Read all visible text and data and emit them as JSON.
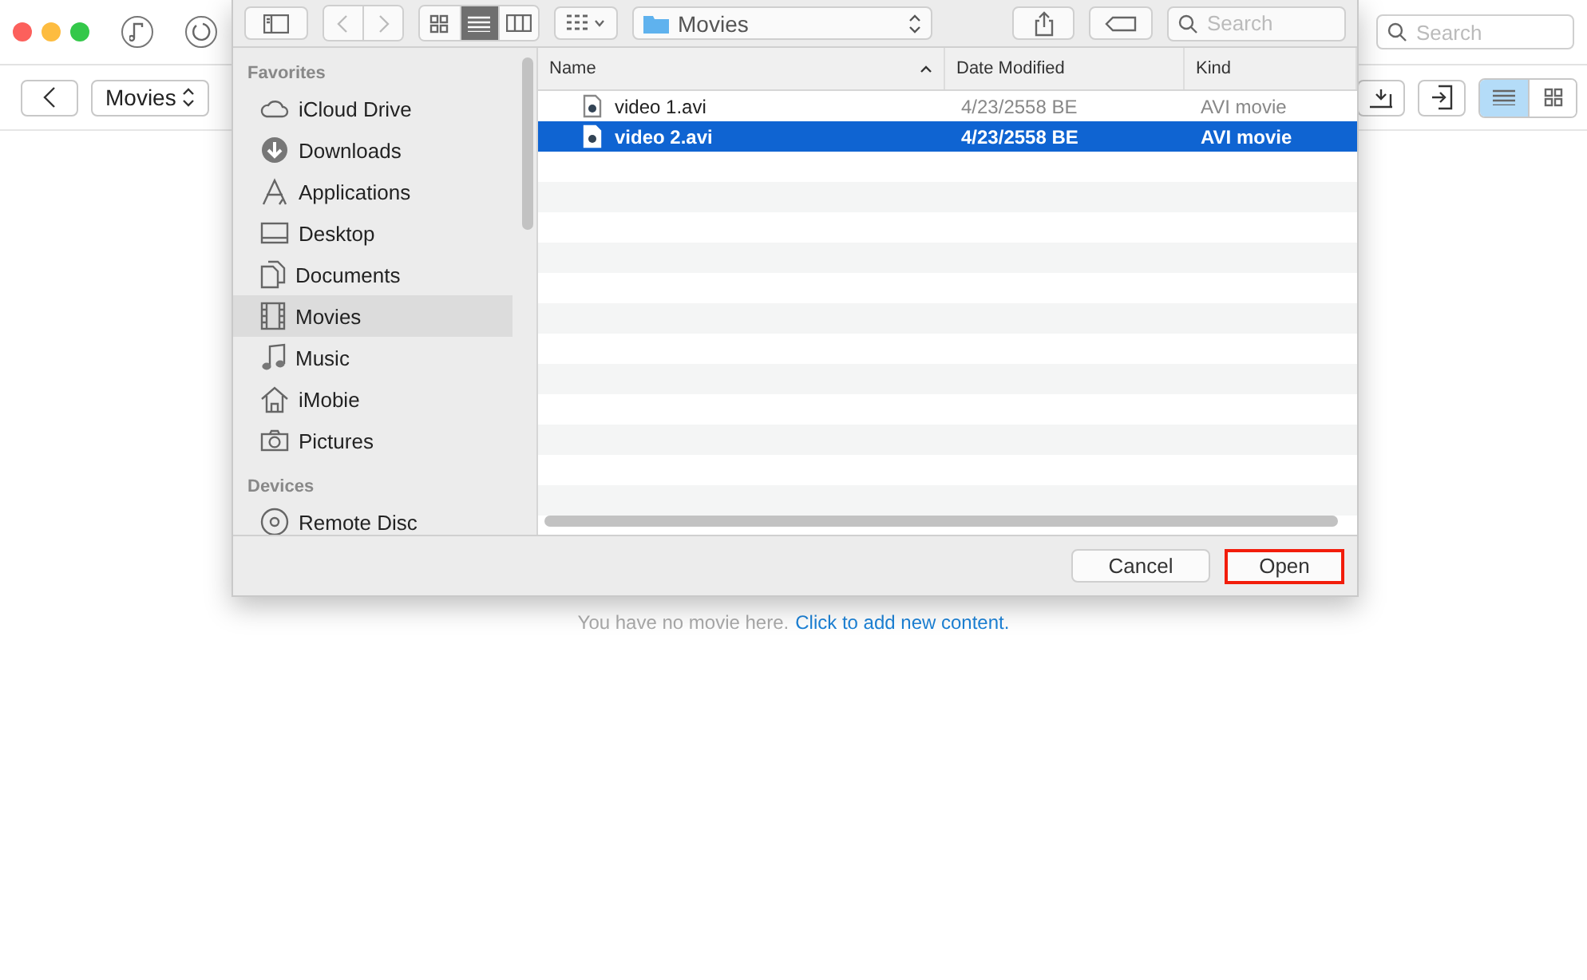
{
  "app": {
    "search": {
      "placeholder": "Search"
    },
    "location": "Movies",
    "view_buttons": [
      {
        "kind": "list",
        "selected": true
      },
      {
        "kind": "grid",
        "selected": false
      }
    ],
    "empty_message": {
      "text": "You have no movie here.",
      "link": "Click to add new content."
    }
  },
  "dialog": {
    "view_buttons": [
      {
        "kind": "icons",
        "selected": false
      },
      {
        "kind": "list",
        "selected": true
      },
      {
        "kind": "columns",
        "selected": false
      }
    ],
    "location": "Movies",
    "search": {
      "placeholder": "Search"
    },
    "sidebar": [
      {
        "heading": "Favorites",
        "items": [
          {
            "label": "iCloud Drive",
            "kind": "cloud",
            "selected": false
          },
          {
            "label": "Downloads",
            "kind": "download",
            "selected": false
          },
          {
            "label": "Applications",
            "kind": "apps",
            "selected": false
          },
          {
            "label": "Desktop",
            "kind": "desktop",
            "selected": false
          },
          {
            "label": "Documents",
            "kind": "documents",
            "selected": false
          },
          {
            "label": "Movies",
            "kind": "film",
            "selected": true
          },
          {
            "label": "Music",
            "kind": "music",
            "selected": false
          },
          {
            "label": "iMobie",
            "kind": "home",
            "selected": false
          },
          {
            "label": "Pictures",
            "kind": "camera",
            "selected": false
          }
        ]
      },
      {
        "heading": "Devices",
        "items": [
          {
            "label": "Remote Disc",
            "kind": "disc",
            "selected": false
          }
        ]
      }
    ],
    "columns": [
      "Name",
      "Date Modified",
      "Kind"
    ],
    "rows": [
      {
        "name": "video 1.avi",
        "date": "4/23/2558 BE",
        "kind": "AVI movie",
        "selected": false
      },
      {
        "name": "video 2.avi",
        "date": "4/23/2558 BE",
        "kind": "AVI movie",
        "selected": true
      }
    ],
    "buttons": [
      {
        "label": "Cancel",
        "highlighted": false
      },
      {
        "label": "Open",
        "highlighted": true
      }
    ]
  }
}
